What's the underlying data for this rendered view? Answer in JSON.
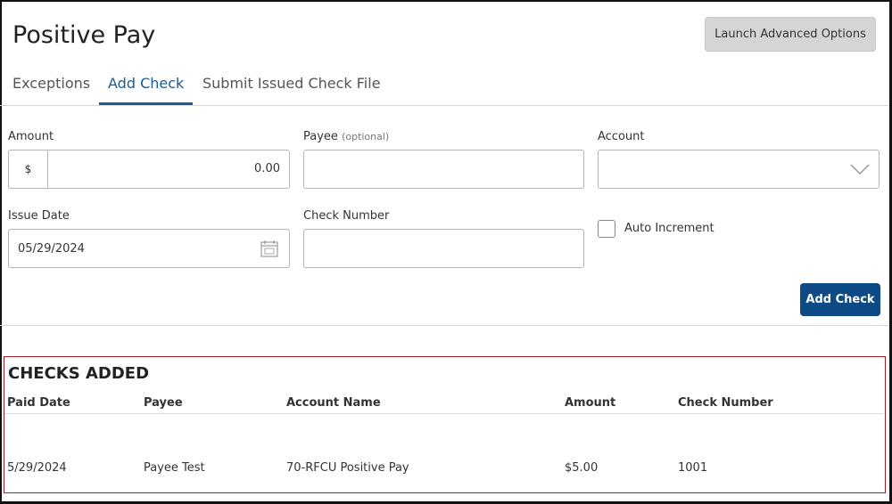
{
  "header": {
    "title": "Positive Pay",
    "launch_label": "Launch Advanced Options"
  },
  "tabs": [
    {
      "label": "Exceptions"
    },
    {
      "label": "Add Check"
    },
    {
      "label": "Submit Issued Check File"
    }
  ],
  "form": {
    "amount": {
      "label": "Amount",
      "prefix": "$",
      "value": "0.00"
    },
    "payee": {
      "label": "Payee",
      "hint": "(optional)",
      "value": ""
    },
    "account": {
      "label": "Account",
      "value": ""
    },
    "issue_date": {
      "label": "Issue Date",
      "value": "05/29/2024"
    },
    "check_number": {
      "label": "Check Number",
      "value": ""
    },
    "auto_increment": {
      "label": "Auto Increment",
      "checked": false
    },
    "submit_label": "Add Check"
  },
  "checks_added": {
    "title": "CHECKS ADDED",
    "columns": [
      "Paid Date",
      "Payee",
      "Account Name",
      "Amount",
      "Check Number"
    ],
    "rows": [
      [
        "5/29/2024",
        "Payee Test",
        "70-RFCU Positive Pay",
        "$5.00",
        "1001"
      ]
    ]
  }
}
